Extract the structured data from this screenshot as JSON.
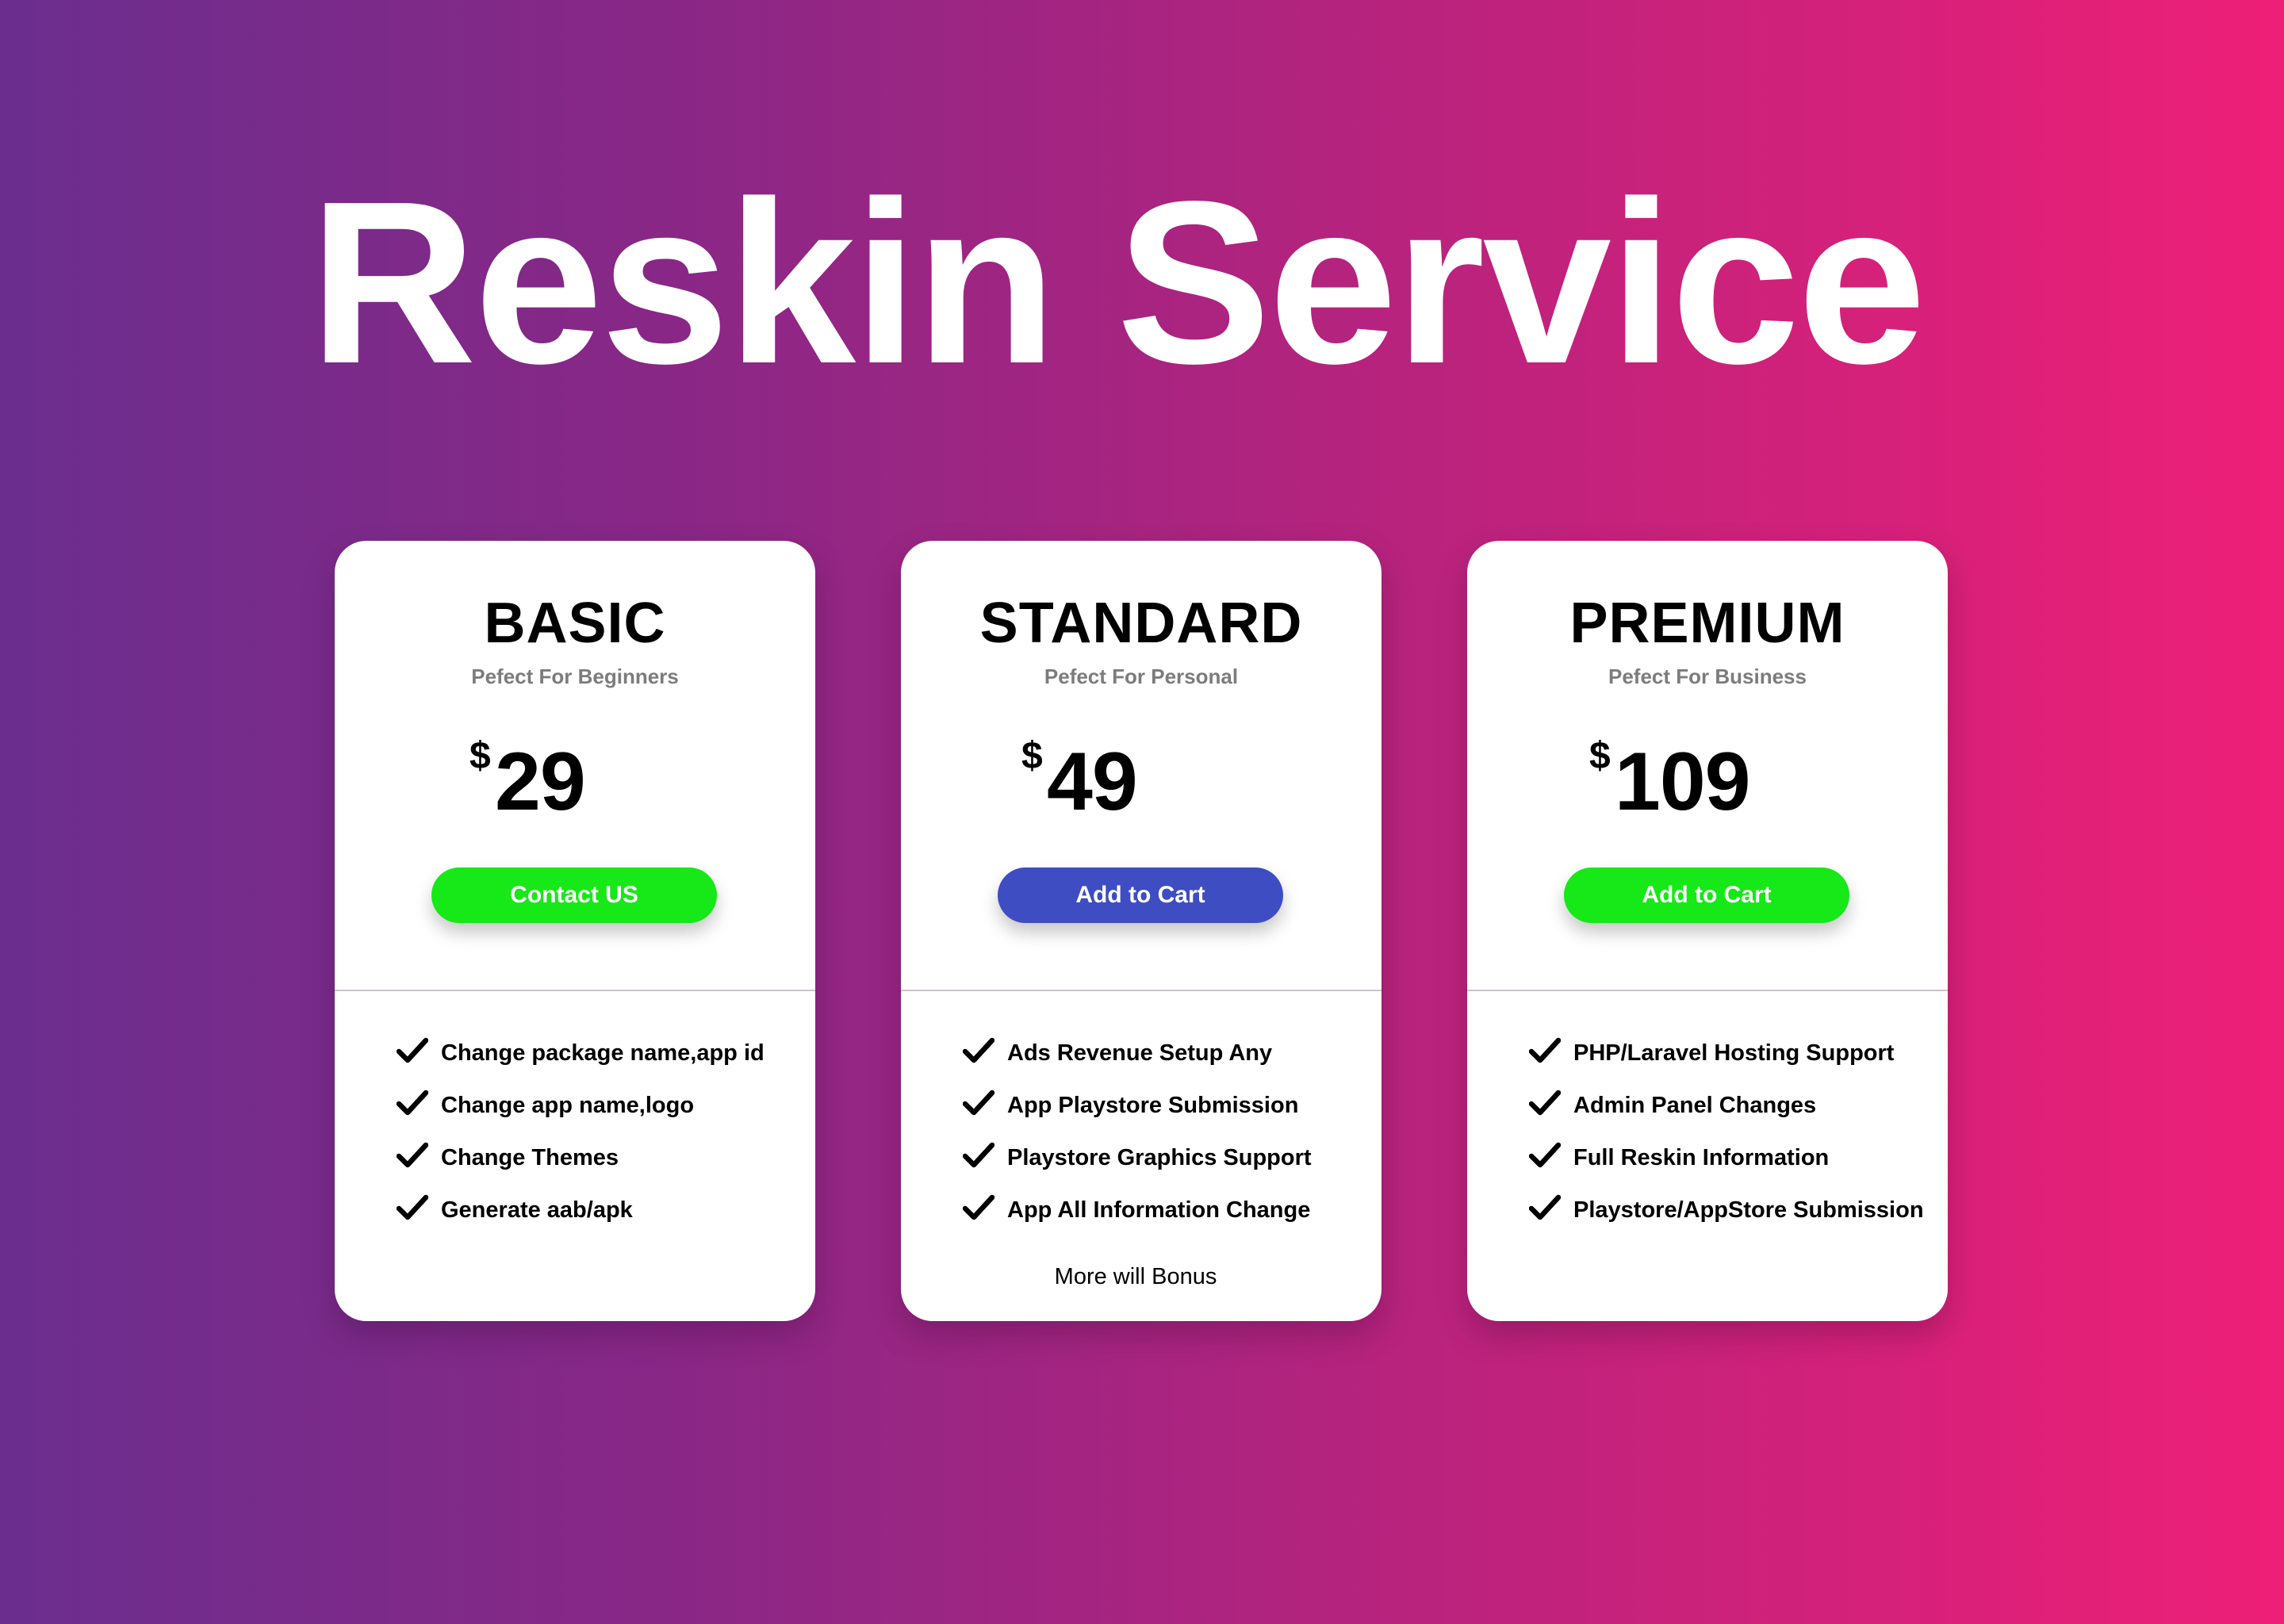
{
  "title": "Reskin Service",
  "colors": {
    "background_start": "#6b2e8e",
    "background_end": "#ee1f77",
    "card": "#ffffff",
    "button_green": "#17e817",
    "button_blue": "#3e4dc1"
  },
  "icons": {
    "feature_bullet": "check-icon"
  },
  "plans": [
    {
      "name": "BASIC",
      "subtitle": "Pefect For Beginners",
      "currency": "$",
      "price": "29",
      "button_label": "Contact US",
      "button_color": "#17e817",
      "features": [
        "Change package name,app id",
        "Change app name,logo",
        "Change Themes",
        "Generate aab/apk"
      ]
    },
    {
      "name": "STANDARD",
      "subtitle": "Pefect For Personal",
      "currency": "$",
      "price": "49",
      "button_label": "Add to Cart",
      "button_color": "#3e4dc1",
      "features": [
        "Ads Revenue Setup Any",
        "App Playstore Submission",
        "Playstore Graphics Support",
        "App All Information Change"
      ],
      "note": "More will Bonus"
    },
    {
      "name": "PREMIUM",
      "subtitle": "Pefect For Business",
      "currency": "$",
      "price": "109",
      "button_label": "Add to Cart",
      "button_color": "#17e817",
      "features": [
        "PHP/Laravel Hosting Support",
        "Admin Panel Changes",
        "Full Reskin  Information",
        "Playstore/AppStore Submission"
      ]
    }
  ]
}
